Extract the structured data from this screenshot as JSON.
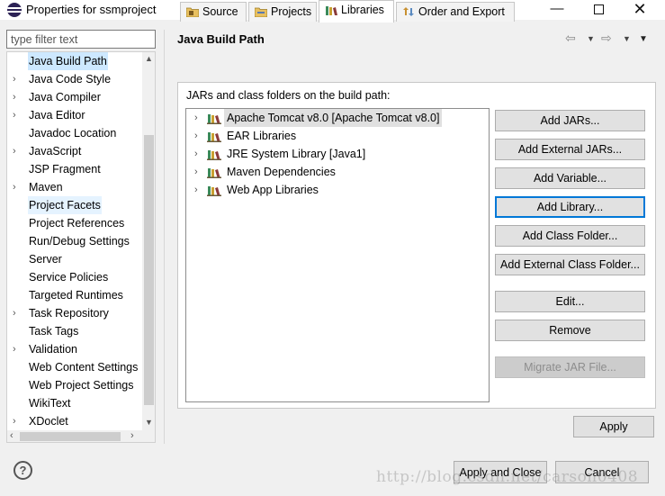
{
  "window": {
    "title": "Properties for ssmproject",
    "minimize": "—",
    "close": "✕"
  },
  "filter": {
    "placeholder": "type filter text"
  },
  "categories": [
    {
      "label": "Java Build Path",
      "expandable": false,
      "selected": true
    },
    {
      "label": "Java Code Style",
      "expandable": true
    },
    {
      "label": "Java Compiler",
      "expandable": true
    },
    {
      "label": "Java Editor",
      "expandable": true
    },
    {
      "label": "Javadoc Location",
      "expandable": false
    },
    {
      "label": "JavaScript",
      "expandable": true
    },
    {
      "label": "JSP Fragment",
      "expandable": false
    },
    {
      "label": "Maven",
      "expandable": true
    },
    {
      "label": "Project Facets",
      "expandable": false,
      "hover": true
    },
    {
      "label": "Project References",
      "expandable": false
    },
    {
      "label": "Run/Debug Settings",
      "expandable": false
    },
    {
      "label": "Server",
      "expandable": false
    },
    {
      "label": "Service Policies",
      "expandable": false
    },
    {
      "label": "Targeted Runtimes",
      "expandable": false
    },
    {
      "label": "Task Repository",
      "expandable": true
    },
    {
      "label": "Task Tags",
      "expandable": false
    },
    {
      "label": "Validation",
      "expandable": true
    },
    {
      "label": "Web Content Settings",
      "expandable": false
    },
    {
      "label": "Web Project Settings",
      "expandable": false
    },
    {
      "label": "WikiText",
      "expandable": false
    },
    {
      "label": "XDoclet",
      "expandable": true
    }
  ],
  "page": {
    "title": "Java Build Path",
    "tabs": [
      {
        "label": "Source",
        "icon": "source-folder-icon"
      },
      {
        "label": "Projects",
        "icon": "projects-folder-icon"
      },
      {
        "label": "Libraries",
        "icon": "libraries-icon",
        "active": true
      },
      {
        "label": "Order and Export",
        "icon": "order-export-icon"
      }
    ],
    "panel_label": "JARs and class folders on the build path:",
    "libraries": [
      {
        "label": "Apache Tomcat v8.0 [Apache Tomcat v8.0]",
        "selected": true
      },
      {
        "label": "EAR Libraries"
      },
      {
        "label": "JRE System Library [Java1]"
      },
      {
        "label": "Maven Dependencies"
      },
      {
        "label": "Web App Libraries"
      }
    ],
    "buttons": {
      "add_jars": "Add JARs...",
      "add_external_jars": "Add External JARs...",
      "add_variable": "Add Variable...",
      "add_library": "Add Library...",
      "add_class_folder": "Add Class Folder...",
      "add_external_class_folder": "Add External Class Folder...",
      "edit": "Edit...",
      "remove": "Remove",
      "migrate_jar": "Migrate JAR File..."
    },
    "apply": "Apply"
  },
  "footer": {
    "help": "?",
    "apply_and_close": "Apply and Close",
    "cancel": "Cancel"
  },
  "watermark": "http://blog.csdn.net/carson0408",
  "colors": {
    "selection": "#cde8ff",
    "focus_border": "#0078d7",
    "button_face": "#e1e1e1"
  }
}
